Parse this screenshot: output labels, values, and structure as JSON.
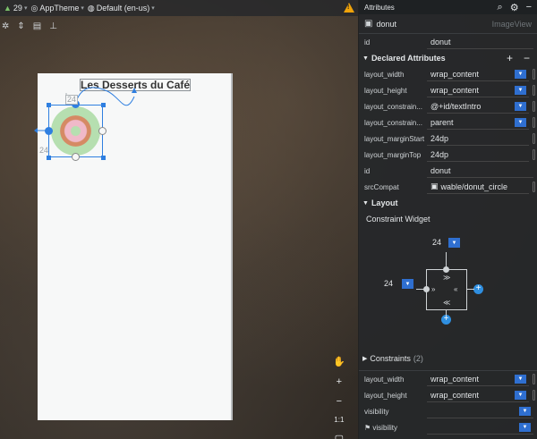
{
  "toolbar": {
    "api_level": "29",
    "theme": "AppTheme",
    "locale": "Default (en-us)"
  },
  "canvas": {
    "title_text": "Les Desserts du Café",
    "margin_top": "24",
    "margin_start": "24"
  },
  "panel": {
    "header": "Attributes",
    "component_name": "donut",
    "component_type": "ImageView",
    "id_label": "id",
    "id_value": "donut",
    "declared_title": "Declared Attributes",
    "declared": [
      {
        "name": "layout_width",
        "value": "wrap_content"
      },
      {
        "name": "layout_height",
        "value": "wrap_content"
      },
      {
        "name": "layout_constrain...",
        "value": "@+id/textIntro"
      },
      {
        "name": "layout_constrain...",
        "value": "parent"
      },
      {
        "name": "layout_marginStart",
        "value": "24dp"
      },
      {
        "name": "layout_marginTop",
        "value": "24dp"
      },
      {
        "name": "id",
        "value": "donut"
      },
      {
        "name": "srcCompat",
        "value": "wable/donut_circle"
      }
    ],
    "layout_title": "Layout",
    "constraint_widget_label": "Constraint Widget",
    "widget_top_value": "24",
    "widget_left_value": "24",
    "constraints_label": "Constraints",
    "constraints_count": "(2)",
    "bottom_attrs": [
      {
        "name": "layout_width",
        "value": "wrap_content"
      },
      {
        "name": "layout_height",
        "value": "wrap_content"
      },
      {
        "name": "visibility",
        "value": ""
      },
      {
        "name": "visibility",
        "value": ""
      }
    ]
  },
  "zoom": {
    "one_to_one": "1:1"
  },
  "colors": {
    "accent": "#2f7fe0",
    "warning": "#f0a30a",
    "donut_bg": "#b6dfb0"
  }
}
